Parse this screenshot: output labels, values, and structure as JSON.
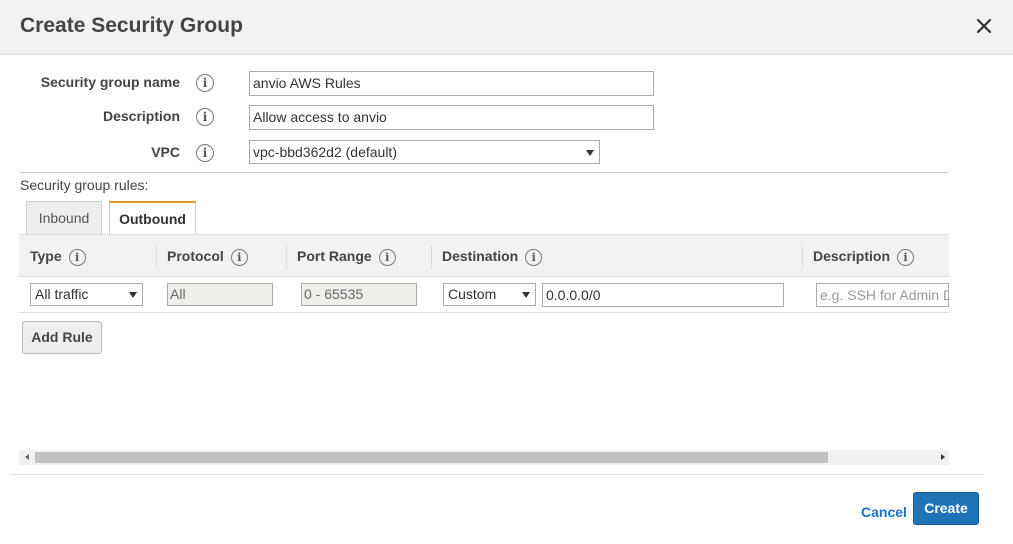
{
  "dialog": {
    "title": "Create Security Group",
    "close_icon": "close-icon"
  },
  "form": {
    "name_label": "Security group name",
    "name_value": "anvio AWS Rules",
    "description_label": "Description",
    "description_value": "Allow access to anvio",
    "vpc_label": "VPC",
    "vpc_value": "vpc-bbd362d2 (default)",
    "info_icon_glyph": "i"
  },
  "rules": {
    "label": "Security group rules:",
    "tabs": [
      {
        "label": "Inbound",
        "active": false
      },
      {
        "label": "Outbound",
        "active": true
      }
    ],
    "columns": [
      "Type",
      "Protocol",
      "Port Range",
      "Destination",
      "Description"
    ],
    "row": {
      "type": "All traffic",
      "protocol": "All",
      "port_range": "0 - 65535",
      "destination_type": "Custom",
      "destination_value": "0.0.0.0/0",
      "description_placeholder": "e.g. SSH for Admin De"
    },
    "add_rule_label": "Add Rule"
  },
  "footer": {
    "cancel_label": "Cancel",
    "create_label": "Create"
  },
  "colors": {
    "primary_button": "#1f73b7",
    "link": "#1a73c7",
    "active_tab_accent": "#e7952c"
  }
}
